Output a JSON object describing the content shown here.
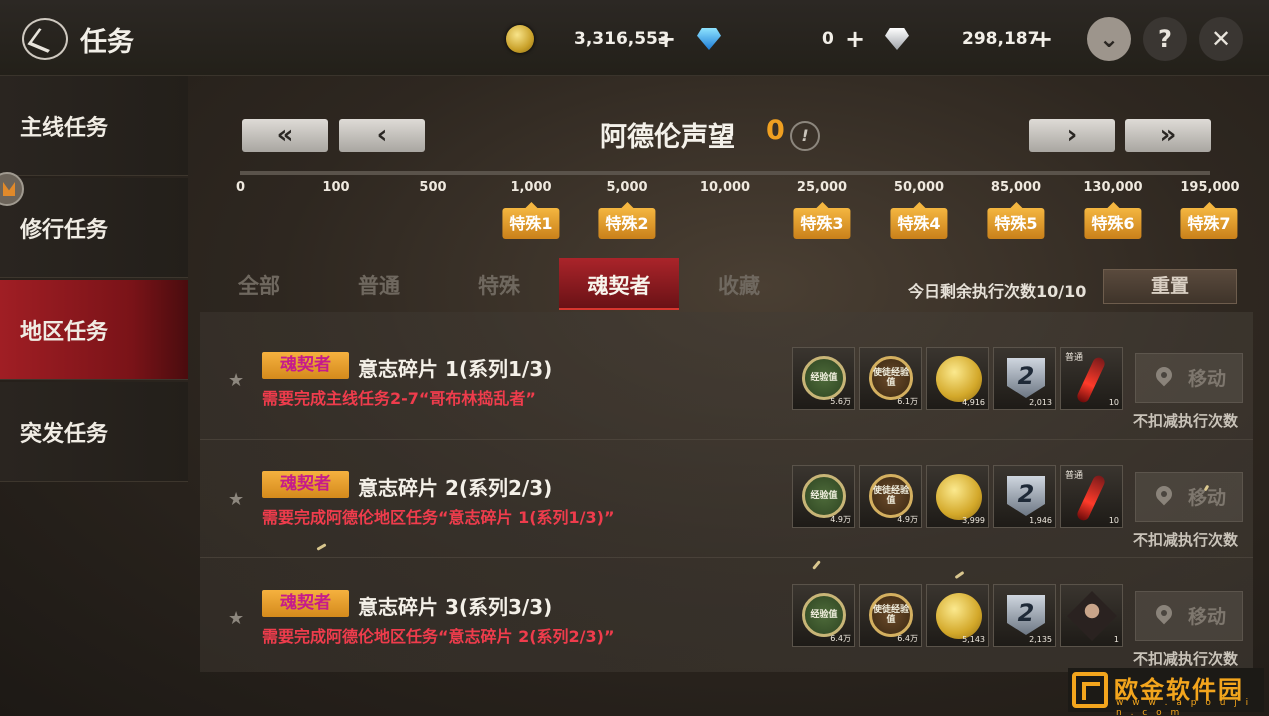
{
  "header": {
    "title": "任务",
    "gold": "3,316,553",
    "blue_gem": "0",
    "white_gem": "298,187",
    "plus": "+",
    "dropdown_label": "⌄",
    "help_label": "?",
    "close_label": "✕"
  },
  "sidebar": {
    "items": [
      {
        "label": "主线任务"
      },
      {
        "label": "修行任务"
      },
      {
        "label": "地区任务"
      },
      {
        "label": "突发任务"
      }
    ]
  },
  "reputation": {
    "title": "阿德伦声望",
    "value": "0",
    "info": "!",
    "nav": {
      "first": "«",
      "prev": "‹",
      "next": "›",
      "last": "»"
    },
    "ticks": [
      "0",
      "100",
      "500",
      "1,000",
      "5,000",
      "10,000",
      "25,000",
      "50,000",
      "85,000",
      "130,000",
      "195,000"
    ],
    "specials": [
      "特殊1",
      "特殊2",
      "特殊3",
      "特殊4",
      "特殊5",
      "特殊6",
      "特殊7"
    ]
  },
  "tabs": [
    {
      "label": "全部"
    },
    {
      "label": "普通"
    },
    {
      "label": "特殊"
    },
    {
      "label": "魂契者"
    },
    {
      "label": "收藏"
    }
  ],
  "remaining": "今日剩余执行次数10/10",
  "reset_label": "重置",
  "quests": [
    {
      "badge": "魂契者",
      "name": "意志碎片 1(系列1/3)",
      "requirement": "需要完成主线任务2-7“哥布林捣乱者”",
      "rewards": {
        "exp": "经验值",
        "exp_count": "5.6万",
        "pet_exp": "使徒经验值",
        "pet_exp_count": "6.1万",
        "gold_count": "4,916",
        "rank_count": "2,013",
        "last_label": "普通",
        "last_count": "10"
      },
      "move": "移动",
      "note": "不扣减执行次数"
    },
    {
      "badge": "魂契者",
      "name": "意志碎片 2(系列2/3)",
      "requirement": "需要完成阿德伦地区任务“意志碎片 1(系列1/3)”",
      "rewards": {
        "exp": "经验值",
        "exp_count": "4.9万",
        "pet_exp": "使徒经验值",
        "pet_exp_count": "4.9万",
        "gold_count": "3,999",
        "rank_count": "1,946",
        "last_label": "普通",
        "last_count": "10"
      },
      "move": "移动",
      "note": "不扣减执行次数"
    },
    {
      "badge": "魂契者",
      "name": "意志碎片 3(系列3/3)",
      "requirement": "需要完成阿德伦地区任务“意志碎片 2(系列2/3)”",
      "rewards": {
        "exp": "经验值",
        "exp_count": "6.4万",
        "pet_exp": "使徒经验值",
        "pet_exp_count": "6.4万",
        "gold_count": "5,143",
        "rank_count": "2,135",
        "last_label": "",
        "last_count": "1"
      },
      "move": "移动",
      "note": "不扣减执行次数"
    }
  ],
  "rank_glyph": "2",
  "star_glyph": "★",
  "watermark": {
    "text": "欧金软件园",
    "url": "w w w . a p o u j i n . c o m"
  }
}
